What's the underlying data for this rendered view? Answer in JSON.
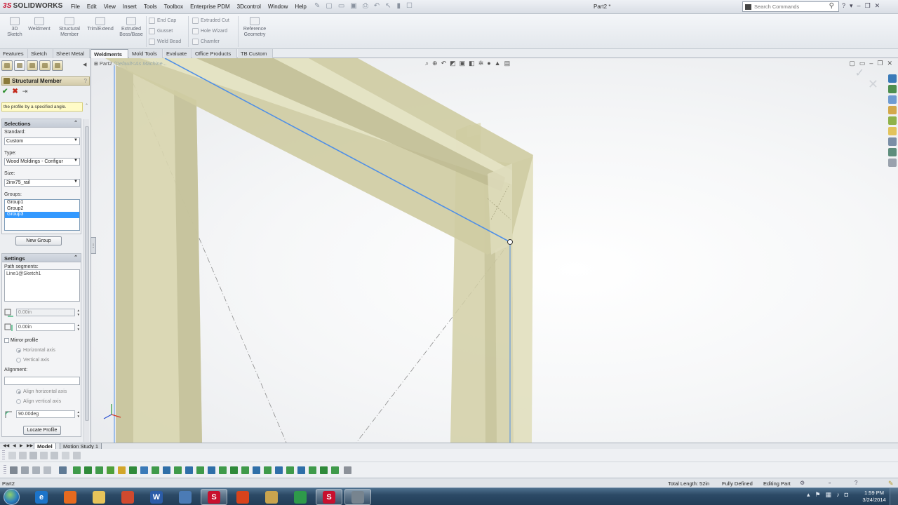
{
  "app": {
    "logo_ds": "3S",
    "logo_text": "SOLIDWORKS",
    "doc_title": "Part2 *",
    "menu": [
      "File",
      "Edit",
      "View",
      "Insert",
      "Tools",
      "Toolbox",
      "Enterprise PDM",
      "3Dcontrol",
      "Window",
      "Help"
    ],
    "search_placeholder": "Search Commands"
  },
  "command_manager": {
    "tools": {
      "sketch3d": "3D Sketch",
      "weldment": "Weldment",
      "structural_member": "Structural Member",
      "trim_extend": "Trim/Extend",
      "extruded_boss": "Extruded Boss/Base",
      "end_cap": "End Cap",
      "gusset": "Gusset",
      "weld_bead": "Weld Bead",
      "extruded_cut": "Extruded Cut",
      "hole_wizard": "Hole Wizard",
      "chamfer": "Chamfer",
      "reference_geometry": "Reference Geometry"
    },
    "tabs": [
      "Features",
      "Sketch",
      "Sheet Metal",
      "Weldments",
      "Mold Tools",
      "Evaluate",
      "Office Products",
      "TB Custom"
    ],
    "active_tab": "Weldments"
  },
  "property_manager": {
    "title": "Structural Member",
    "help": "?",
    "message": "the profile by a specified angle.",
    "selections": {
      "header": "Selections",
      "standard_label": "Standard:",
      "standard_value": "Custom",
      "type_label": "Type:",
      "type_value": "Wood Moldings - Configur",
      "size_label": "Size:",
      "size_value": "2inx75_rail",
      "groups_label": "Groups:",
      "groups": [
        "Group1",
        "Group2",
        "Group3"
      ],
      "selected_group_index": 2,
      "new_group_label": "New Group"
    },
    "settings": {
      "header": "Settings",
      "path_segments_label": "Path segments:",
      "path_segment_value": "Line1@Sketch1",
      "offset1_value": "0.00in",
      "offset2_value": "0.00in",
      "mirror_label": "Mirror profile",
      "horizontal_axis_label": "Horizontal axis",
      "vertical_axis_label": "Vertical axis",
      "alignment_label": "Alignment:",
      "align_horizontal_label": "Align horizontal axis",
      "align_vertical_label": "Align vertical axis",
      "angle_value": "90.00deg",
      "locate_profile_label": "Locate Profile"
    }
  },
  "viewport": {
    "tree_label": "Part2",
    "tree_config": "(Default<As Machine..."
  },
  "bottom_tabs": [
    "Model",
    "Motion Study 1"
  ],
  "status_bar": {
    "doc": "Part2",
    "total_length": "Total Length: 52in",
    "state": "Fully Defined",
    "mode": "Editing Part"
  },
  "clock": {
    "time": "1:59 PM",
    "date": "3/24/2014"
  },
  "colors": {
    "wood": "#d8d5a8",
    "selection_blue": "#4f8fe6",
    "list_highlight": "#3399ff",
    "message_bg": "#fffbc7"
  },
  "taskbar_apps": [
    {
      "icon": "internet-explorer-icon",
      "glyph": "e",
      "color": "#1c74c9"
    },
    {
      "icon": "firefox-icon",
      "glyph": "",
      "color": "#e66a1f"
    },
    {
      "icon": "folder-icon",
      "glyph": "",
      "color": "#e8c45a"
    },
    {
      "icon": "paint-icon",
      "glyph": "",
      "color": "#d04a2f"
    },
    {
      "icon": "word-icon",
      "glyph": "W",
      "color": "#2b5ca8"
    },
    {
      "icon": "sketch-app-icon",
      "glyph": "",
      "color": "#4b7bb5"
    },
    {
      "icon": "solidworks-explorer-icon",
      "glyph": "S",
      "color": "#c8102e"
    },
    {
      "icon": "red-star-icon",
      "glyph": "",
      "color": "#d8431b"
    },
    {
      "icon": "file-manager-icon",
      "glyph": "",
      "color": "#c9a44e"
    },
    {
      "icon": "chrome-icon",
      "glyph": "",
      "color": "#2e9a4a"
    },
    {
      "icon": "solidworks-icon",
      "glyph": "S",
      "color": "#c8102e"
    },
    {
      "icon": "tool-app-icon",
      "glyph": "",
      "color": "#77848f"
    }
  ]
}
